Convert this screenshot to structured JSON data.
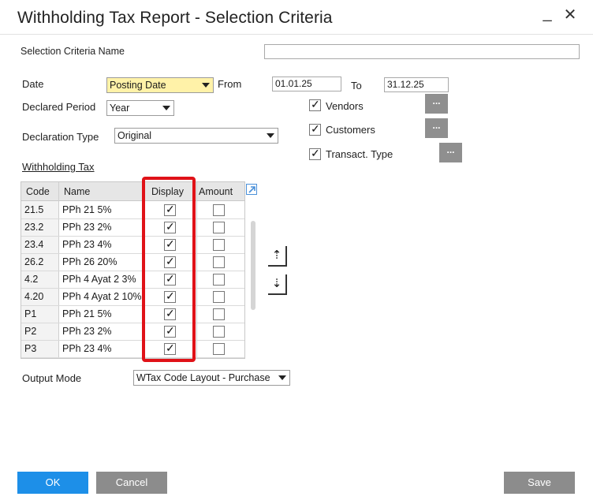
{
  "window": {
    "title": "Withholding Tax Report - Selection Criteria",
    "minimize": "_",
    "close": "✕"
  },
  "selection_criteria_name": {
    "label": "Selection Criteria Name",
    "value": ""
  },
  "date": {
    "label": "Date",
    "type_value": "Posting Date",
    "from_label": "From",
    "from_value": "01.01.25",
    "to_label": "To",
    "to_value": "31.12.25"
  },
  "declared_period": {
    "label": "Declared Period",
    "value": "Year"
  },
  "declaration_type": {
    "label": "Declaration Type",
    "value": "Original"
  },
  "filters": [
    {
      "label": "Vendors",
      "checked": true,
      "button": "..."
    },
    {
      "label": "Customers",
      "checked": true,
      "button": "..."
    },
    {
      "label": "Transact. Type",
      "checked": true,
      "button": "..."
    }
  ],
  "withholding_tax": {
    "label": "Withholding Tax",
    "columns": [
      "Code",
      "Name",
      "Display",
      "Amount"
    ],
    "rows": [
      {
        "code": "21.5",
        "name": "PPh 21 5%",
        "display": true,
        "amount": false
      },
      {
        "code": "23.2",
        "name": "PPh 23 2%",
        "display": true,
        "amount": false
      },
      {
        "code": "23.4",
        "name": "PPh 23 4%",
        "display": true,
        "amount": false
      },
      {
        "code": "26.2",
        "name": "PPh 26 20%",
        "display": true,
        "amount": false
      },
      {
        "code": "4.2",
        "name": "PPh 4 Ayat 2 3%",
        "display": true,
        "amount": false
      },
      {
        "code": "4.20",
        "name": "PPh 4 Ayat 2 10%",
        "display": true,
        "amount": false
      },
      {
        "code": "P1",
        "name": "PPh 21 5%",
        "display": true,
        "amount": false
      },
      {
        "code": "P2",
        "name": "PPh 23 2%",
        "display": true,
        "amount": false
      },
      {
        "code": "P3",
        "name": "PPh 23 4%",
        "display": true,
        "amount": false
      }
    ]
  },
  "move_buttons": {
    "up": "⇡",
    "down": "⇣"
  },
  "output_mode": {
    "label": "Output Mode",
    "value": "WTax Code Layout - Purchase"
  },
  "buttons": {
    "ok": "OK",
    "cancel": "Cancel",
    "save": "Save"
  },
  "colors": {
    "highlight_box": "#e01218",
    "ok_button": "#1d8fe8",
    "gray_button": "#8c8c8c"
  }
}
